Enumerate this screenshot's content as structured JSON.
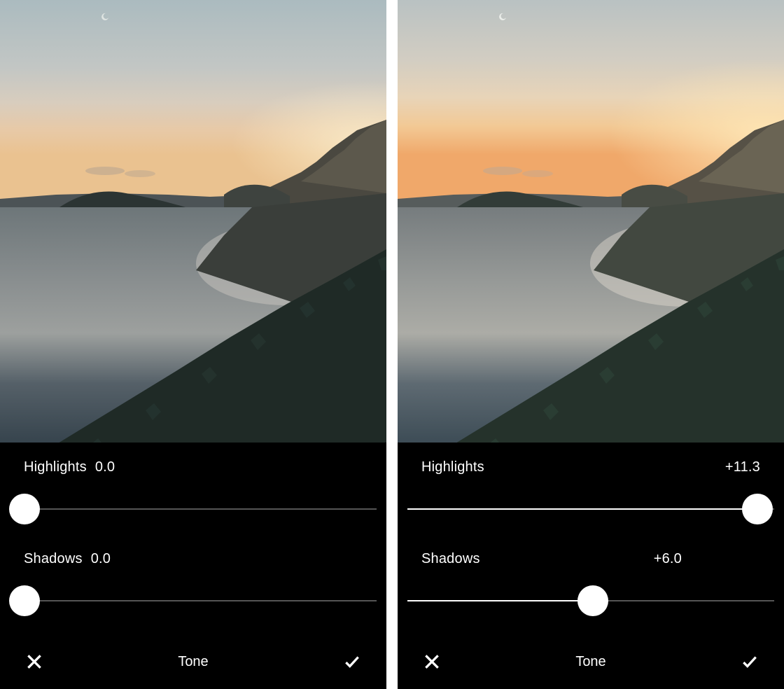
{
  "left": {
    "highlights": {
      "label": "Highlights",
      "value": "0.0",
      "position": 0.04
    },
    "shadows": {
      "label": "Shadows",
      "value": "0.0",
      "position": 0.04
    },
    "tool_title": "Tone"
  },
  "right": {
    "highlights": {
      "label": "Highlights",
      "value": "+11.3",
      "position": 0.955
    },
    "shadows": {
      "label": "Shadows",
      "value": "+6.0",
      "position": 0.505
    },
    "tool_title": "Tone"
  },
  "icons": {
    "cancel": "close-icon",
    "confirm": "check-icon"
  }
}
